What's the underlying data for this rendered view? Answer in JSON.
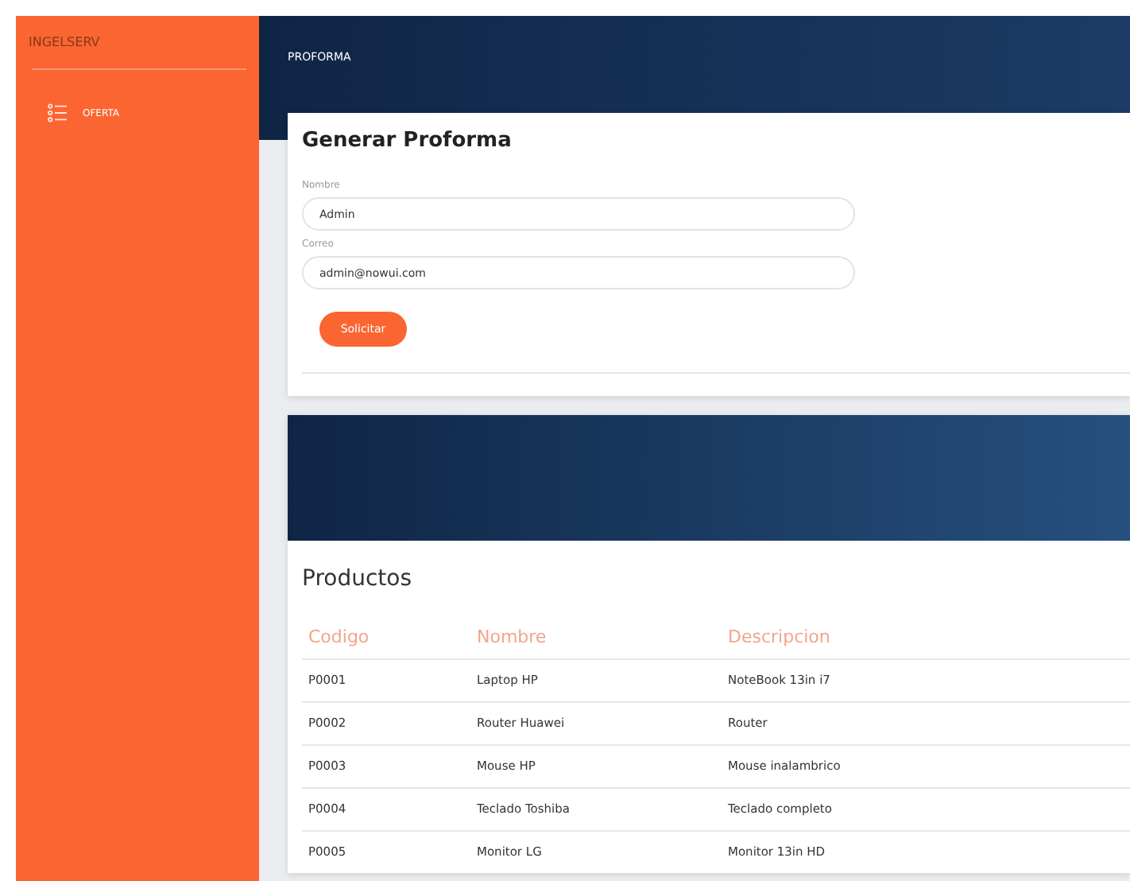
{
  "sidebar": {
    "brand": "INGELSERV",
    "items": [
      {
        "label": "OFERTA"
      }
    ]
  },
  "header": {
    "title": "PROFORMA"
  },
  "form_card": {
    "title": "Generar Proforma",
    "fields": [
      {
        "label": "Nombre",
        "value": "Admin"
      },
      {
        "label": "Correo",
        "value": "admin@nowui.com"
      }
    ],
    "button": "Solicitar"
  },
  "products": {
    "title": "Productos",
    "columns": [
      "Codigo",
      "Nombre",
      "Descripcion"
    ],
    "rows": [
      [
        "P0001",
        "Laptop HP",
        "NoteBook 13in i7"
      ],
      [
        "P0002",
        "Router Huawei",
        "Router"
      ],
      [
        "P0003",
        "Mouse HP",
        "Mouse inalambrico"
      ],
      [
        "P0004",
        "Teclado Toshiba",
        "Teclado completo"
      ],
      [
        "P0005",
        "Monitor LG",
        "Monitor 13in HD"
      ]
    ]
  }
}
